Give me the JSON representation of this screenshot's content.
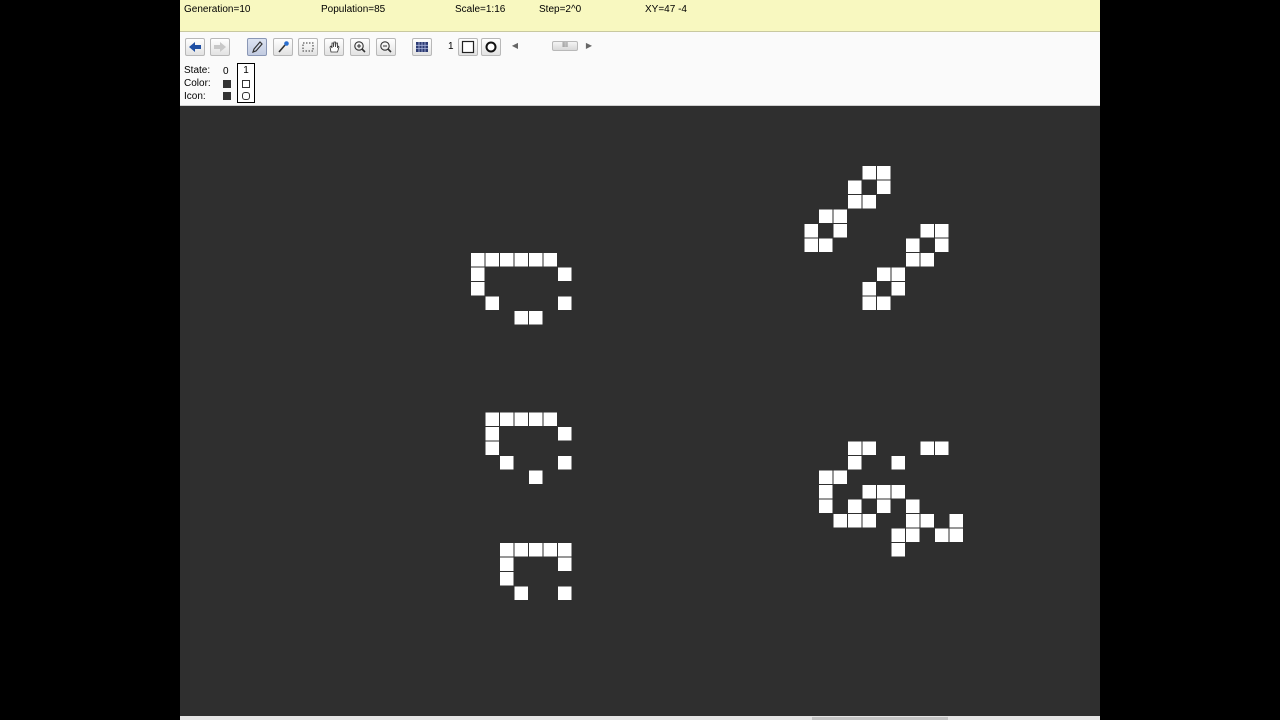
{
  "status": {
    "generation": "Generation=10",
    "population": "Population=85",
    "scale": "Scale=1:16",
    "step": "Step=2^0",
    "xy": "XY=47 -4"
  },
  "toolbar": {
    "layer_number": "1",
    "scroll_thumb_label": "III",
    "scroll_left_arrow": "◀",
    "scroll_right_arrow": "▶"
  },
  "states": {
    "state_label": "State:",
    "color_label": "Color:",
    "icon_label": "Icon:",
    "dead_state": "0",
    "live_state": "1",
    "dead_color": "#333333",
    "live_color": "#ffffff"
  },
  "grid": {
    "background_color": "#2f2f2f",
    "live_cell_color": "#ffffff",
    "live_cells": [
      [
        10,
        10
      ],
      [
        11,
        10
      ],
      [
        12,
        10
      ],
      [
        13,
        10
      ],
      [
        14,
        10
      ],
      [
        15,
        10
      ],
      [
        10,
        11
      ],
      [
        16,
        11
      ],
      [
        10,
        12
      ],
      [
        11,
        13
      ],
      [
        16,
        13
      ],
      [
        13,
        14
      ],
      [
        14,
        14
      ],
      [
        11,
        21
      ],
      [
        12,
        21
      ],
      [
        13,
        21
      ],
      [
        14,
        21
      ],
      [
        15,
        21
      ],
      [
        11,
        22
      ],
      [
        16,
        22
      ],
      [
        11,
        23
      ],
      [
        12,
        24
      ],
      [
        16,
        24
      ],
      [
        14,
        25
      ],
      [
        12,
        30
      ],
      [
        13,
        30
      ],
      [
        14,
        30
      ],
      [
        15,
        30
      ],
      [
        16,
        30
      ],
      [
        12,
        31
      ],
      [
        16,
        31
      ],
      [
        12,
        32
      ],
      [
        13,
        33
      ],
      [
        16,
        33
      ],
      [
        37,
        4
      ],
      [
        38,
        4
      ],
      [
        36,
        5
      ],
      [
        38,
        5
      ],
      [
        36,
        6
      ],
      [
        37,
        6
      ],
      [
        34,
        7
      ],
      [
        35,
        7
      ],
      [
        33,
        8
      ],
      [
        35,
        8
      ],
      [
        41,
        8
      ],
      [
        42,
        8
      ],
      [
        33,
        9
      ],
      [
        34,
        9
      ],
      [
        40,
        9
      ],
      [
        42,
        9
      ],
      [
        40,
        10
      ],
      [
        41,
        10
      ],
      [
        38,
        11
      ],
      [
        39,
        11
      ],
      [
        37,
        12
      ],
      [
        39,
        12
      ],
      [
        37,
        13
      ],
      [
        38,
        13
      ],
      [
        36,
        23
      ],
      [
        37,
        23
      ],
      [
        41,
        23
      ],
      [
        42,
        23
      ],
      [
        36,
        24
      ],
      [
        39,
        24
      ],
      [
        34,
        25
      ],
      [
        35,
        25
      ],
      [
        34,
        26
      ],
      [
        37,
        26
      ],
      [
        38,
        26
      ],
      [
        39,
        26
      ],
      [
        34,
        27
      ],
      [
        36,
        27
      ],
      [
        38,
        27
      ],
      [
        40,
        27
      ],
      [
        35,
        28
      ],
      [
        36,
        28
      ],
      [
        37,
        28
      ],
      [
        40,
        28
      ],
      [
        41,
        28
      ],
      [
        43,
        28
      ],
      [
        39,
        29
      ],
      [
        40,
        29
      ],
      [
        42,
        29
      ],
      [
        43,
        29
      ],
      [
        39,
        30
      ]
    ]
  }
}
